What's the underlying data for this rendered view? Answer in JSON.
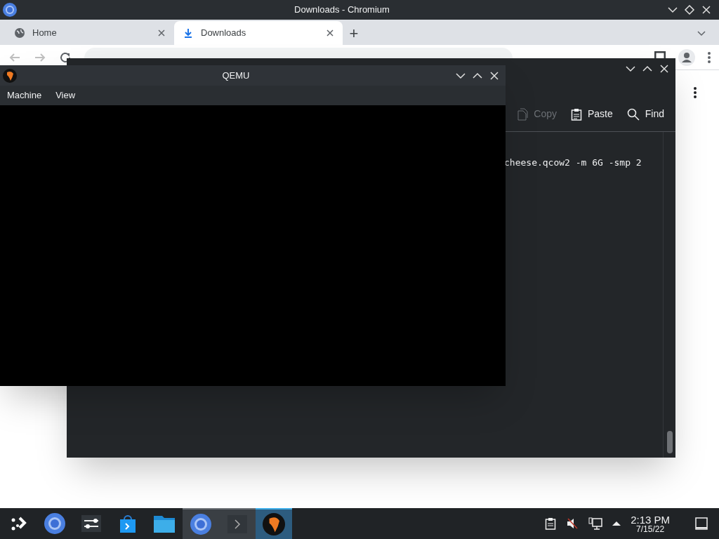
{
  "browser": {
    "title": "Downloads - Chromium",
    "tabs": [
      {
        "label": "Home",
        "kind": "globe",
        "selected": false
      },
      {
        "label": "Downloads",
        "kind": "download",
        "selected": true
      }
    ],
    "new_tab": "+"
  },
  "terminal": {
    "toolbar": [
      {
        "label": "Copy",
        "kind": "copy",
        "disabled": true
      },
      {
        "label": "Paste",
        "kind": "paste",
        "disabled": false
      },
      {
        "label": "Find",
        "kind": "find",
        "disabled": false
      }
    ],
    "lines": [
      "cheese.qcow2 -m 6G -smp 2"
    ]
  },
  "qemu": {
    "title": "QEMU",
    "menus": [
      "Machine",
      "View"
    ]
  },
  "taskbar": {
    "items": [
      {
        "kind": "launcher",
        "open": false,
        "active": false
      },
      {
        "kind": "chromium",
        "open": false,
        "active": false
      },
      {
        "kind": "settings",
        "open": false,
        "active": false
      },
      {
        "kind": "store",
        "open": false,
        "active": false
      },
      {
        "kind": "files",
        "open": false,
        "active": false
      },
      {
        "kind": "chromium",
        "open": true,
        "active": false
      },
      {
        "kind": "terminal",
        "open": true,
        "active": false
      },
      {
        "kind": "qemu",
        "active": true
      }
    ],
    "time": "2:13 PM",
    "date": "7/15/22"
  }
}
